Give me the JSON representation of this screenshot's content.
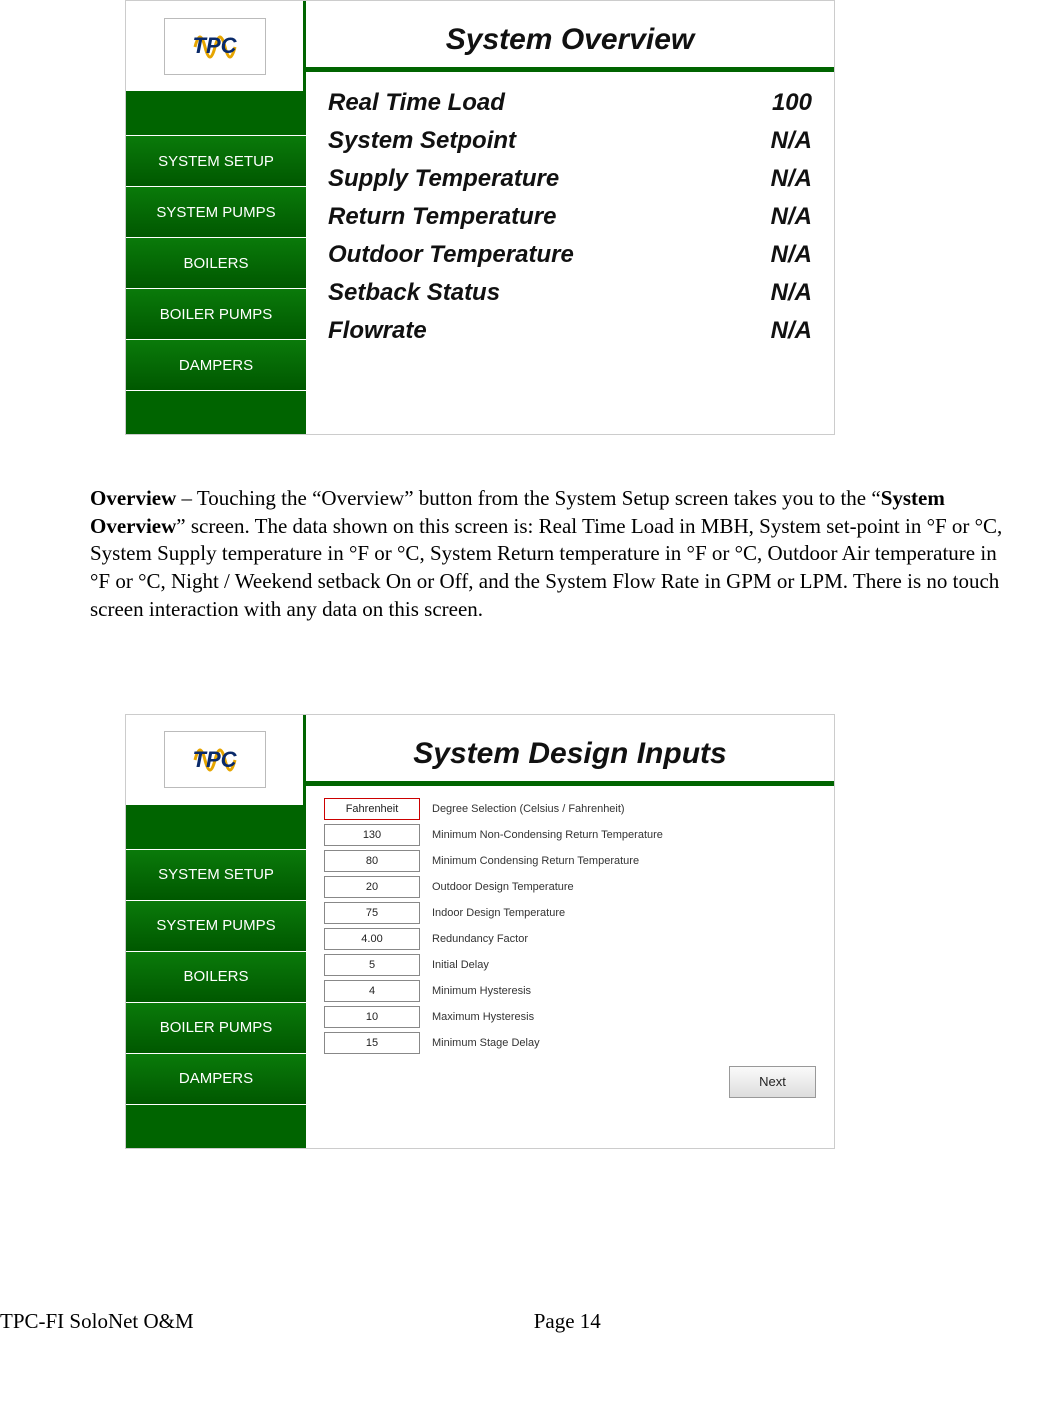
{
  "nav": {
    "items": [
      "SYSTEM SETUP",
      "SYSTEM PUMPS",
      "BOILERS",
      "BOILER PUMPS",
      "DAMPERS"
    ]
  },
  "logo": {
    "text": "TPC"
  },
  "screen1": {
    "title": "System Overview",
    "rows": [
      {
        "label": "Real Time Load",
        "value": "100"
      },
      {
        "label": "System Setpoint",
        "value": "N/A"
      },
      {
        "label": "Supply Temperature",
        "value": "N/A"
      },
      {
        "label": "Return Temperature",
        "value": "N/A"
      },
      {
        "label": "Outdoor Temperature",
        "value": "N/A"
      },
      {
        "label": "Setback Status",
        "value": "N/A"
      },
      {
        "label": "Flowrate",
        "value": "N/A"
      }
    ]
  },
  "screen2": {
    "title": "System Design Inputs",
    "rows": [
      {
        "value": "Fahrenheit",
        "label": "Degree Selection (Celsius / Fahrenheit)",
        "highlight": true
      },
      {
        "value": "130",
        "label": "Minimum Non-Condensing Return Temperature"
      },
      {
        "value": "80",
        "label": "Minimum Condensing Return Temperature"
      },
      {
        "value": "20",
        "label": "Outdoor Design Temperature"
      },
      {
        "value": "75",
        "label": "Indoor Design Temperature"
      },
      {
        "value": "4.00",
        "label": "Redundancy Factor"
      },
      {
        "value": "5",
        "label": "Initial Delay"
      },
      {
        "value": "4",
        "label": "Minimum Hysteresis"
      },
      {
        "value": "10",
        "label": "Maximum Hysteresis"
      },
      {
        "value": "15",
        "label": "Minimum Stage Delay"
      }
    ],
    "next": "Next"
  },
  "paragraph": {
    "lead_bold": "Overview",
    "lead_rest": " – Touching the “Overview” button from the System Setup screen takes you to the “",
    "mid_bold": "System Overview",
    "rest": "” screen.  The data shown on this screen is: Real Time Load in MBH, System set-point in °F or °C, System Supply temperature in °F or °C, System Return temperature in °F or °C, Outdoor Air temperature in °F or °C, Night / Weekend setback On or Off, and the System Flow Rate in GPM or LPM.  There is no touch screen interaction with any data on this screen."
  },
  "footer": {
    "left": "TPC-FI SoloNet O&M",
    "page": "Page 14"
  }
}
